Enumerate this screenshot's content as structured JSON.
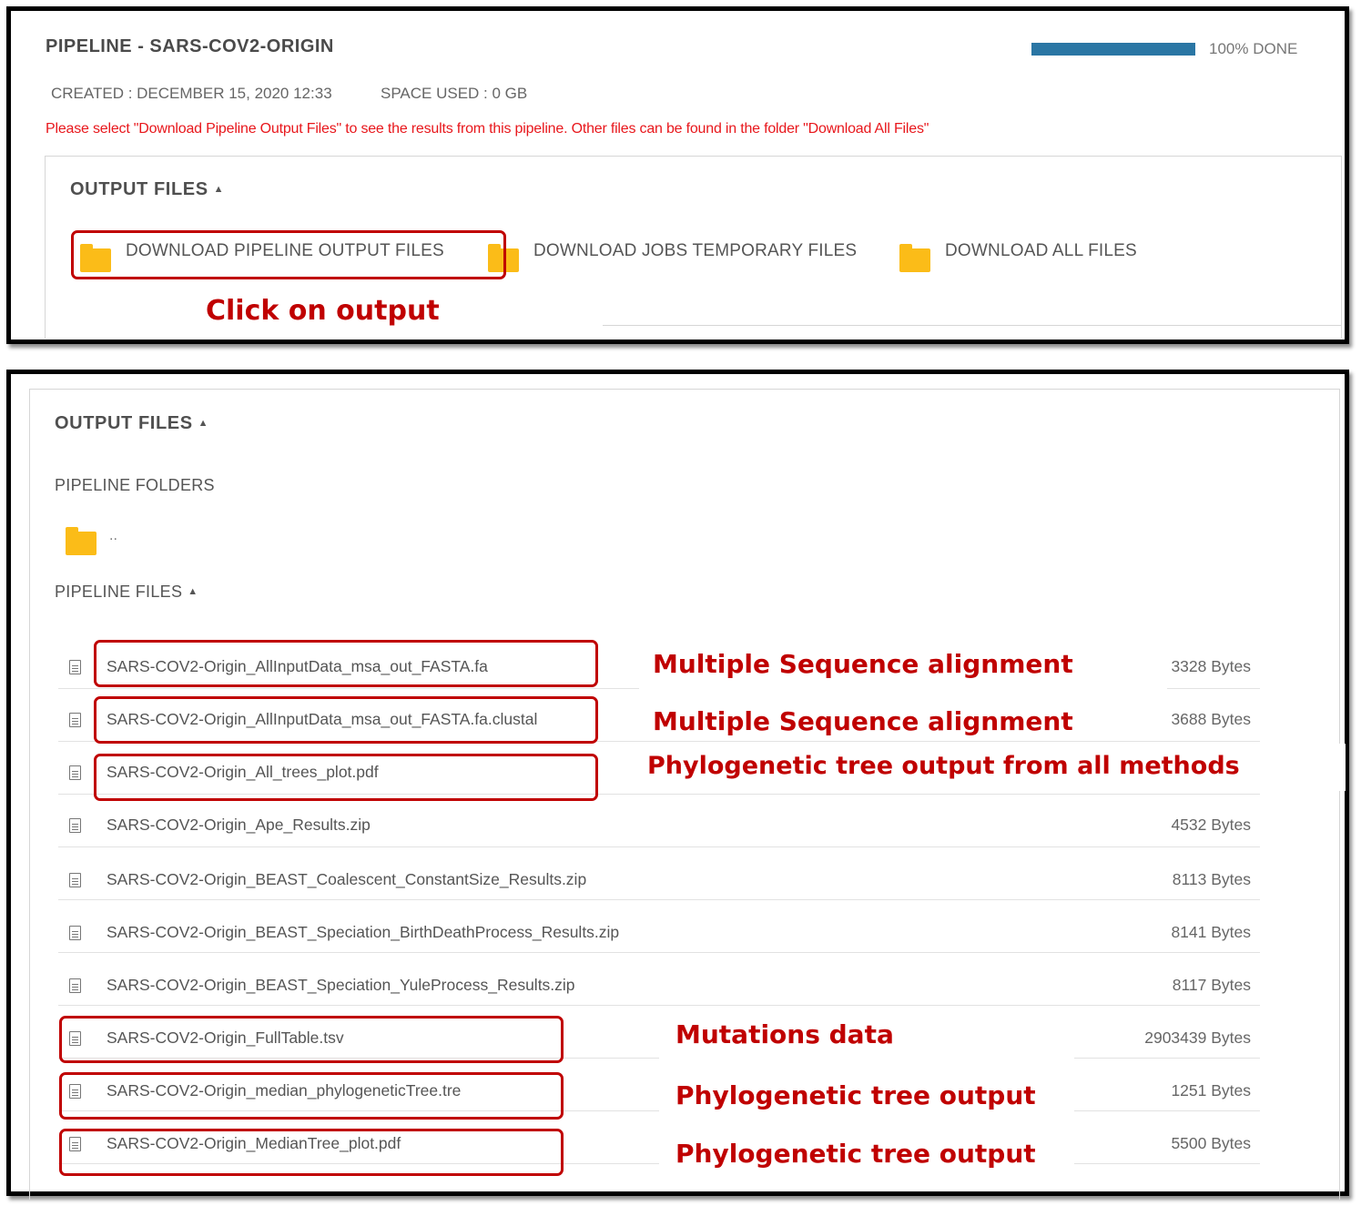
{
  "pipeline": {
    "title": "PIPELINE - SARS-COV2-ORIGIN",
    "progress_fraction": 1.0,
    "progress_label": "100% DONE",
    "created": "CREATED : DECEMBER 15, 2020 12:33",
    "space_used": "SPACE USED : 0 GB",
    "warning": "Please select \"Download Pipeline Output Files\" to see the results from this pipeline. Other files can be found in the folder \"Download All Files\""
  },
  "output_files": {
    "title": "OUTPUT FILES",
    "caret": "▲",
    "downloads": [
      {
        "label": "DOWNLOAD PIPELINE OUTPUT FILES",
        "icon": "folder-icon"
      },
      {
        "label": "DOWNLOAD JOBS TEMPORARY FILES",
        "icon": "folder-icon"
      },
      {
        "label": "DOWNLOAD ALL FILES",
        "icon": "folder-icon"
      }
    ],
    "click_annotation": "Click on output"
  },
  "detail": {
    "title": "OUTPUT FILES",
    "caret": "▲",
    "folders_title": "PIPELINE FOLDERS",
    "parent_folder": "..",
    "files_title": "PIPELINE FILES",
    "files": [
      {
        "name": "SARS-COV2-Origin_AllInputData_msa_out_FASTA.fa",
        "size": "3328 Bytes",
        "icon": "file-icon"
      },
      {
        "name": "SARS-COV2-Origin_AllInputData_msa_out_FASTA.fa.clustal",
        "size": "3688 Bytes",
        "icon": "file-icon"
      },
      {
        "name": "SARS-COV2-Origin_All_trees_plot.pdf",
        "size": "",
        "icon": "file-icon"
      },
      {
        "name": "SARS-COV2-Origin_Ape_Results.zip",
        "size": "4532 Bytes",
        "icon": "file-icon"
      },
      {
        "name": "SARS-COV2-Origin_BEAST_Coalescent_ConstantSize_Results.zip",
        "size": "8113 Bytes",
        "icon": "file-icon"
      },
      {
        "name": "SARS-COV2-Origin_BEAST_Speciation_BirthDeathProcess_Results.zip",
        "size": "8141 Bytes",
        "icon": "file-icon"
      },
      {
        "name": "SARS-COV2-Origin_BEAST_Speciation_YuleProcess_Results.zip",
        "size": "8117 Bytes",
        "icon": "file-icon"
      },
      {
        "name": "SARS-COV2-Origin_FullTable.tsv",
        "size": "2903439 Bytes",
        "icon": "file-icon"
      },
      {
        "name": "SARS-COV2-Origin_median_phylogeneticTree.tre",
        "size": "1251 Bytes",
        "icon": "file-icon"
      },
      {
        "name": "SARS-COV2-Origin_MedianTree_plot.pdf",
        "size": "5500 Bytes",
        "icon": "file-icon"
      }
    ],
    "annotations": {
      "msa_1": "Multiple Sequence alignment",
      "msa_2": "Multiple Sequence alignment",
      "all_trees": "Phylogenetic tree output from all methods",
      "mutations": "Mutations data",
      "tree_1": "Phylogenetic tree output",
      "tree_2": "Phylogenetic tree output"
    }
  },
  "colors": {
    "progress": "#2a76a4",
    "warning": "#e8171c",
    "annotation": "#c00000",
    "folder": "#fbbc18"
  }
}
